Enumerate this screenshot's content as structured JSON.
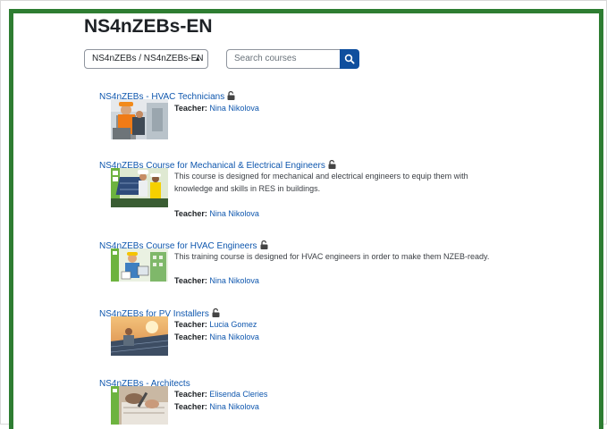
{
  "page": {
    "title": "NS4nZEBs-EN"
  },
  "category_select": {
    "value": "NS4nZEBs / NS4nZEBs-EN"
  },
  "search": {
    "placeholder": "Search courses"
  },
  "courses": [
    {
      "name": "NS4nZEBs - HVAC Technicians",
      "teacher_label": "Teacher:",
      "teachers": [
        "Nina Nikolova"
      ]
    },
    {
      "name": "NS4nZEBs Course for Mechanical & Electrical Engineers",
      "summary": "This course is designed for mechanical and electrical engineers to equip them with knowledge and skills in RES in buildings.",
      "teacher_label": "Teacher:",
      "teachers": [
        "Nina Nikolova"
      ]
    },
    {
      "name": "NS4nZEBs Course for HVAC Engineers",
      "summary": "This training course is designed for HVAC engineers in order to make them NZEB-ready.",
      "teacher_label": "Teacher:",
      "teachers": [
        "Nina Nikolova"
      ]
    },
    {
      "name": "NS4nZEBs for PV Installers",
      "teacher_label": "Teacher:",
      "teachers": [
        "Lucia Gomez",
        "Nina Nikolova"
      ]
    },
    {
      "name": "NS4nZEBs - Architects",
      "teacher_label": "Teacher:",
      "teachers": [
        "Elisenda Cleries",
        "Nina Nikolova"
      ]
    }
  ],
  "icons": {
    "lock": "unlocked-padlock-icon",
    "search": "magnifier-icon"
  },
  "colors": {
    "frame_border": "#2e7d32",
    "link": "#0f57ae",
    "search_button": "#0f4f9e"
  }
}
